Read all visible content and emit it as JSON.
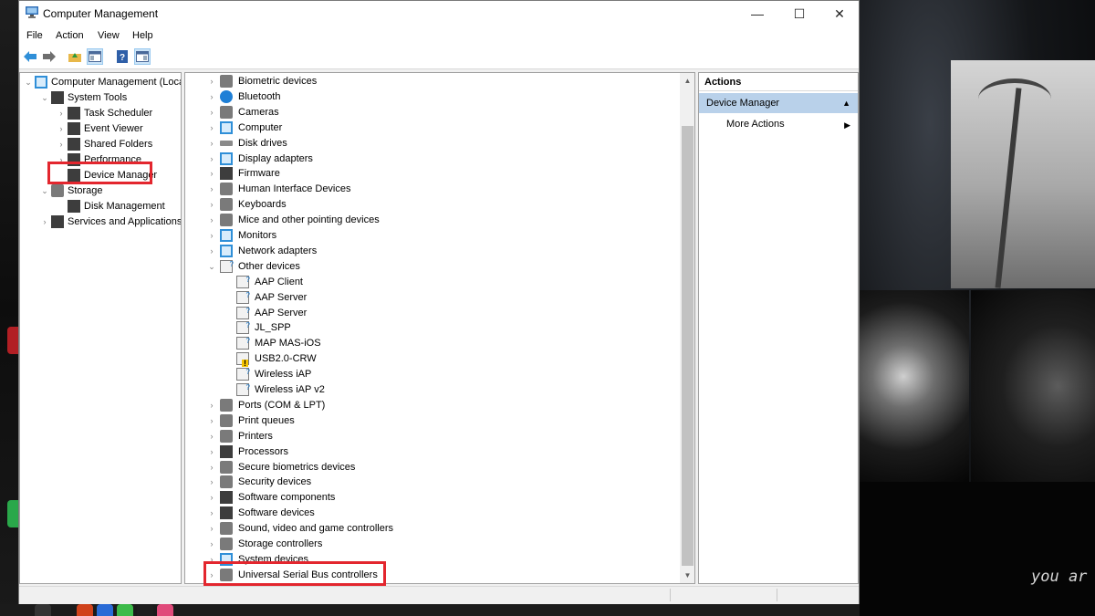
{
  "window": {
    "title": "Computer Management",
    "controls": {
      "minimize": "—",
      "maximize": "☐",
      "close": "✕"
    }
  },
  "menu": [
    "File",
    "Action",
    "View",
    "Help"
  ],
  "nav_tree": [
    {
      "label": "Computer Management (Local)",
      "level": 0,
      "expand": "expanded"
    },
    {
      "label": "System Tools",
      "level": 1,
      "expand": "expanded"
    },
    {
      "label": "Task Scheduler",
      "level": 2,
      "expand": "collapsed"
    },
    {
      "label": "Event Viewer",
      "level": 2,
      "expand": "collapsed"
    },
    {
      "label": "Shared Folders",
      "level": 2,
      "expand": "collapsed"
    },
    {
      "label": "Performance",
      "level": 2,
      "expand": "collapsed"
    },
    {
      "label": "Device Manager",
      "level": 2,
      "expand": "none"
    },
    {
      "label": "Storage",
      "level": 1,
      "expand": "expanded"
    },
    {
      "label": "Disk Management",
      "level": 2,
      "expand": "none"
    },
    {
      "label": "Services and Applications",
      "level": 1,
      "expand": "collapsed"
    }
  ],
  "devices": [
    {
      "label": "Biometric devices",
      "level": 0,
      "expand": "collapsed",
      "icon": "gen"
    },
    {
      "label": "Bluetooth",
      "level": 0,
      "expand": "collapsed",
      "icon": "blue"
    },
    {
      "label": "Cameras",
      "level": 0,
      "expand": "collapsed",
      "icon": "gen"
    },
    {
      "label": "Computer",
      "level": 0,
      "expand": "collapsed",
      "icon": "monitor"
    },
    {
      "label": "Disk drives",
      "level": 0,
      "expand": "collapsed",
      "icon": "disk"
    },
    {
      "label": "Display adapters",
      "level": 0,
      "expand": "collapsed",
      "icon": "monitor"
    },
    {
      "label": "Firmware",
      "level": 0,
      "expand": "collapsed",
      "icon": "board"
    },
    {
      "label": "Human Interface Devices",
      "level": 0,
      "expand": "collapsed",
      "icon": "gen"
    },
    {
      "label": "Keyboards",
      "level": 0,
      "expand": "collapsed",
      "icon": "gen"
    },
    {
      "label": "Mice and other pointing devices",
      "level": 0,
      "expand": "collapsed",
      "icon": "gen"
    },
    {
      "label": "Monitors",
      "level": 0,
      "expand": "collapsed",
      "icon": "monitor"
    },
    {
      "label": "Network adapters",
      "level": 0,
      "expand": "collapsed",
      "icon": "monitor"
    },
    {
      "label": "Other devices",
      "level": 0,
      "expand": "expanded",
      "icon": "other"
    },
    {
      "label": "AAP Client",
      "level": 1,
      "expand": "none",
      "icon": "other"
    },
    {
      "label": "AAP Server",
      "level": 1,
      "expand": "none",
      "icon": "other"
    },
    {
      "label": "AAP Server",
      "level": 1,
      "expand": "none",
      "icon": "other"
    },
    {
      "label": "JL_SPP",
      "level": 1,
      "expand": "none",
      "icon": "other"
    },
    {
      "label": "MAP MAS-iOS",
      "level": 1,
      "expand": "none",
      "icon": "other"
    },
    {
      "label": "USB2.0-CRW",
      "level": 1,
      "expand": "none",
      "icon": "warn"
    },
    {
      "label": "Wireless iAP",
      "level": 1,
      "expand": "none",
      "icon": "other"
    },
    {
      "label": "Wireless iAP v2",
      "level": 1,
      "expand": "none",
      "icon": "other"
    },
    {
      "label": "Ports (COM & LPT)",
      "level": 0,
      "expand": "collapsed",
      "icon": "gen"
    },
    {
      "label": "Print queues",
      "level": 0,
      "expand": "collapsed",
      "icon": "gen"
    },
    {
      "label": "Printers",
      "level": 0,
      "expand": "collapsed",
      "icon": "gen"
    },
    {
      "label": "Processors",
      "level": 0,
      "expand": "collapsed",
      "icon": "board"
    },
    {
      "label": "Secure biometrics devices",
      "level": 0,
      "expand": "collapsed",
      "icon": "gen"
    },
    {
      "label": "Security devices",
      "level": 0,
      "expand": "collapsed",
      "icon": "gen"
    },
    {
      "label": "Software components",
      "level": 0,
      "expand": "collapsed",
      "icon": "board"
    },
    {
      "label": "Software devices",
      "level": 0,
      "expand": "collapsed",
      "icon": "board"
    },
    {
      "label": "Sound, video and game controllers",
      "level": 0,
      "expand": "collapsed",
      "icon": "gen"
    },
    {
      "label": "Storage controllers",
      "level": 0,
      "expand": "collapsed",
      "icon": "gen"
    },
    {
      "label": "System devices",
      "level": 0,
      "expand": "collapsed",
      "icon": "monitor"
    },
    {
      "label": "Universal Serial Bus controllers",
      "level": 0,
      "expand": "collapsed",
      "icon": "gen"
    }
  ],
  "actions": {
    "header": "Actions",
    "section": "Device Manager",
    "items": [
      "More Actions"
    ]
  },
  "highlighted_items": [
    "Device Manager",
    "Universal Serial Bus controllers"
  ],
  "desktop": {
    "wallpaper_text": "you ar"
  },
  "colors": {
    "highlight_border": "#e3262e",
    "selection_bg": "#b9d1ea",
    "accent": "#1e7fd6"
  }
}
